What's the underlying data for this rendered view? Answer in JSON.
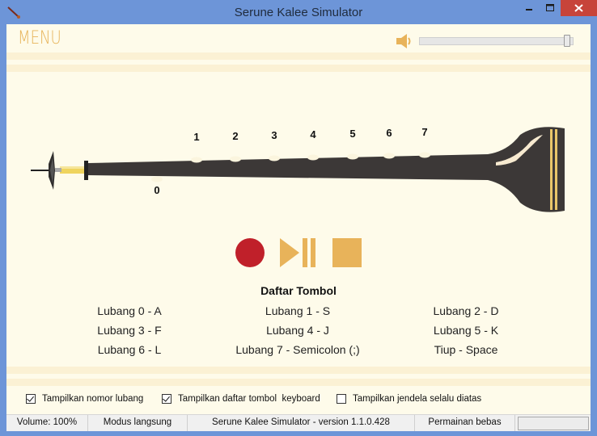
{
  "window": {
    "title": "Serune Kalee Simulator"
  },
  "menu_label": "MENU",
  "volume": {
    "level_percent": 97
  },
  "hole_numbers": [
    "0",
    "1",
    "2",
    "3",
    "4",
    "5",
    "6",
    "7"
  ],
  "key_list": {
    "title": "Daftar Tombol",
    "items": [
      "Lubang 0 - A",
      "Lubang 1 - S",
      "Lubang 2 - D",
      "Lubang 3 - F",
      "Lubang 4 - J",
      "Lubang 5 - K",
      "Lubang 6 - L",
      "Lubang 7 - Semicolon (;)",
      "Tiup - Space"
    ]
  },
  "options": [
    {
      "label": "Tampilkan nomor lubang",
      "checked": true
    },
    {
      "label": "Tampilkan daftar tombol  keyboard",
      "checked": true
    },
    {
      "label": "Tampilkan jendela selalu diatas",
      "checked": false
    }
  ],
  "status": {
    "volume": "Volume: 100%",
    "mode": "Modus langsung",
    "version": "Serune Kalee Simulator - version 1.1.0.428",
    "game": "Permainan bebas"
  },
  "colors": {
    "record": "#c0202a",
    "accent": "#e8b35a",
    "instrument_body": "#3c3837",
    "client_bg": "#fefbea"
  }
}
